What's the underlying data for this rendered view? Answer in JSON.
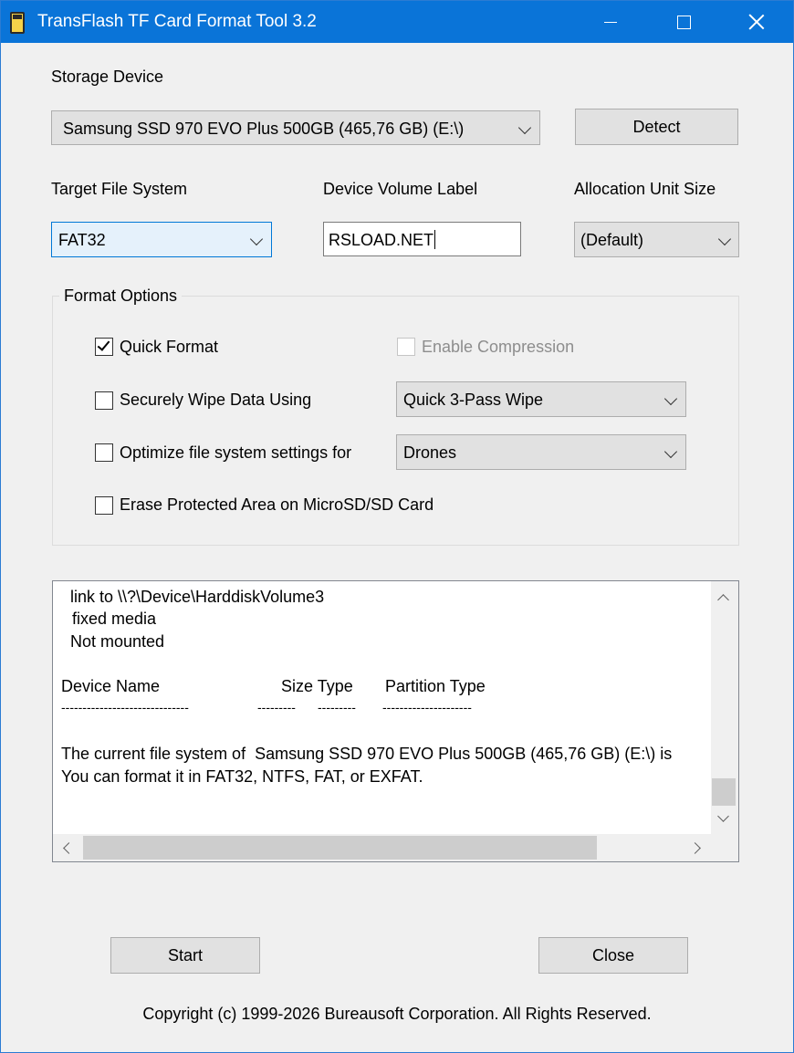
{
  "window": {
    "title": "TransFlash TF Card Format Tool 3.2"
  },
  "storage": {
    "label": "Storage Device",
    "device": "Samsung SSD 970 EVO Plus 500GB (465,76 GB) (E:\\)",
    "detect_label": "Detect"
  },
  "filesystem": {
    "label": "Target File System",
    "value": "FAT32"
  },
  "volume_label": {
    "label": "Device Volume Label",
    "value": "RSLOAD.NET"
  },
  "allocation": {
    "label": "Allocation Unit Size",
    "value": "(Default)"
  },
  "format_options": {
    "title": "Format Options",
    "quick_format": {
      "label": "Quick Format",
      "checked": true
    },
    "enable_compression": {
      "label": "Enable Compression",
      "checked": false,
      "enabled": false
    },
    "secure_wipe": {
      "label": "Securely Wipe Data Using",
      "checked": false,
      "method": "Quick 3-Pass Wipe"
    },
    "optimize": {
      "label": "Optimize file system settings for",
      "checked": false,
      "target": "Drones"
    },
    "erase_protected": {
      "label": "Erase Protected Area on MicroSD/SD Card",
      "checked": false
    }
  },
  "log": {
    "line1": "link to \\\\?\\Device\\HarddiskVolume3",
    "line2": "fixed media",
    "line3": "Not mounted",
    "col_device": "Device Name",
    "col_size_type": "Size Type",
    "col_partition": "Partition Type",
    "dash1": "------------------------------",
    "dash2": "---------",
    "dash3": "---------",
    "dash4": "---------------------",
    "line_current": "The current file system of  Samsung SSD 970 EVO Plus 500GB (465,76 GB) (E:\\) is",
    "line_format": "You can format it in FAT32, NTFS, FAT, or EXFAT."
  },
  "actions": {
    "start_label": "Start",
    "close_label": "Close"
  },
  "footer": {
    "copyright": "Copyright (c) 1999-2026 Bureausoft Corporation. All Rights Reserved."
  }
}
